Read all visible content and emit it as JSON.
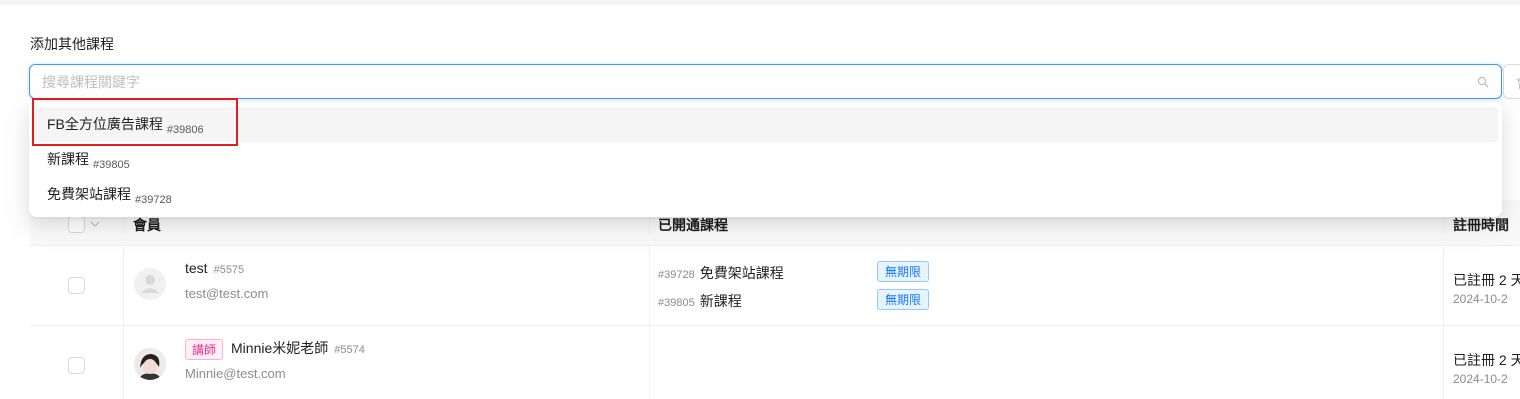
{
  "section": {
    "label": "添加其他課程"
  },
  "search": {
    "placeholder": "搜尋課程關鍵字",
    "icon": "search-icon"
  },
  "edge_field": {
    "partial_text": "會"
  },
  "dropdown": {
    "options": [
      {
        "name": "FB全方位廣告課程",
        "id": "#39806",
        "active": true
      },
      {
        "name": "新課程",
        "id": "#39805",
        "active": false
      },
      {
        "name": "免費架站課程",
        "id": "#39728",
        "active": false
      }
    ]
  },
  "table": {
    "headers": {
      "member": "會員",
      "courses": "已開通課程",
      "registered": "註冊時間"
    },
    "rows": [
      {
        "name": "test",
        "uid": "#5575",
        "email": "test@test.com",
        "role_tag": "",
        "courses": [
          {
            "id": "#39728",
            "name": "免費架站課程",
            "tag": "無期限"
          },
          {
            "id": "#39805",
            "name": "新課程",
            "tag": "無期限"
          }
        ],
        "registered": "已註冊 2 天",
        "date": "2024-10-2"
      },
      {
        "name": "Minnie米妮老師",
        "uid": "#5574",
        "email": "Minnie@test.com",
        "role_tag": "講師",
        "courses": [],
        "registered": "已註冊 2 天",
        "date": "2024-10-2"
      }
    ]
  },
  "colors": {
    "accent": "#1677ff",
    "highlight": "#e11d1d",
    "teacher_tag": "#eb2f96"
  }
}
